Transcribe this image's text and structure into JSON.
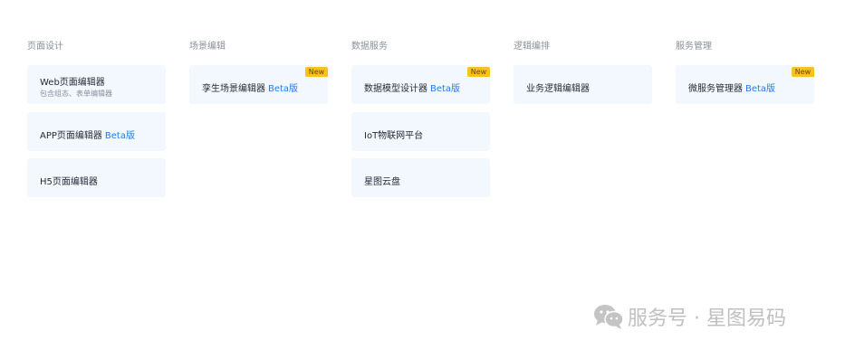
{
  "columns": [
    {
      "title": "页面设计",
      "cards": [
        {
          "title": "Web页面编辑器",
          "subtitle": "包含组态、表单编辑器",
          "beta": "",
          "new": ""
        },
        {
          "title": "APP页面编辑器",
          "subtitle": "",
          "beta": "Beta版",
          "new": ""
        },
        {
          "title": "H5页面编辑器",
          "subtitle": "",
          "beta": "",
          "new": ""
        }
      ]
    },
    {
      "title": "场景编辑",
      "cards": [
        {
          "title": "孪生场景编辑器",
          "subtitle": "",
          "beta": "Beta版",
          "new": "New"
        }
      ]
    },
    {
      "title": "数据服务",
      "cards": [
        {
          "title": "数据模型设计器",
          "subtitle": "",
          "beta": "Beta版",
          "new": "New"
        },
        {
          "title": "IoT物联网平台",
          "subtitle": "",
          "beta": "",
          "new": ""
        },
        {
          "title": "星图云盘",
          "subtitle": "",
          "beta": "",
          "new": ""
        }
      ]
    },
    {
      "title": "逻辑编排",
      "cards": [
        {
          "title": "业务逻辑编辑器",
          "subtitle": "",
          "beta": "",
          "new": ""
        }
      ]
    },
    {
      "title": "服务管理",
      "cards": [
        {
          "title": "微服务管理器",
          "subtitle": "",
          "beta": "Beta版",
          "new": "New"
        }
      ]
    }
  ],
  "watermark": {
    "text": "服务号 · 星图易码",
    "icon": "wechat-icon",
    "color": "#bfbfbf"
  },
  "colors": {
    "card_bg": "#f3f8ff",
    "beta": "#1b7cf0",
    "new_badge": "#fbc21e"
  }
}
